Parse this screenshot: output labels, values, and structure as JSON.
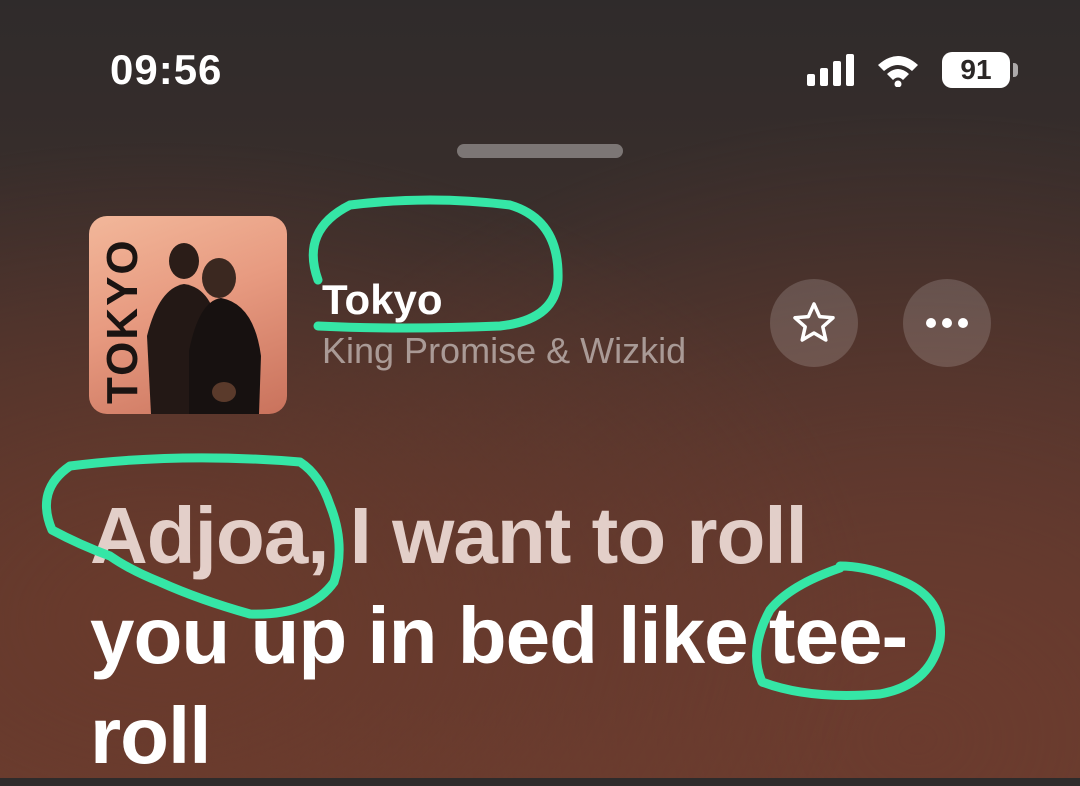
{
  "status_bar": {
    "time": "09:56",
    "battery": "91"
  },
  "now_playing": {
    "title": "Tokyo",
    "artist": "King Promise & Wizkid",
    "artwork_text": "TOKYO"
  },
  "lyrics": {
    "line_1": "Adjoa, I want to roll",
    "line_2": "you up in bed like tee-",
    "line_3": "roll"
  },
  "icons": {
    "signal": "cellular-signal-icon",
    "wifi": "wifi-icon",
    "favorite": "star-icon",
    "more": "ellipsis-icon"
  },
  "colors": {
    "annotation": "#35e6a6",
    "background_top": "#2f2b2b",
    "background_bottom": "#6a3e30"
  }
}
